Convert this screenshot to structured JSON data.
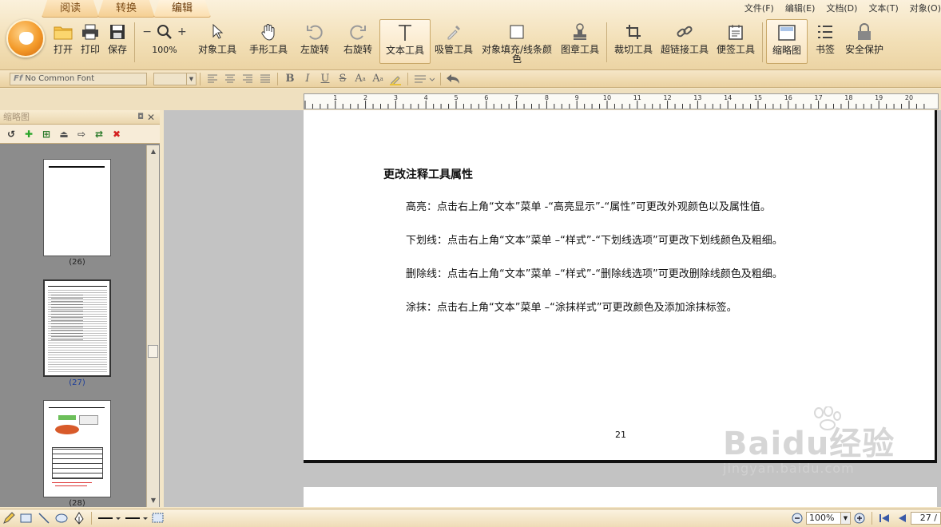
{
  "tabs": [
    "阅读",
    "转换",
    "编辑"
  ],
  "active_tab": "编辑",
  "menubar": [
    "文件(F)",
    "编辑(E)",
    "文档(D)",
    "文本(T)",
    "对象(O)"
  ],
  "toolbar": {
    "open": "打开",
    "print": "打印",
    "save": "保存",
    "zoom_value": "100%",
    "object_tool": "对象工具",
    "hand_tool": "手形工具",
    "rotate_left": "左旋转",
    "rotate_right": "右旋转",
    "text_tool": "文本工具",
    "eyedropper": "吸管工具",
    "fill_stroke": "对象填充/线条颜色",
    "stamp_tool": "图章工具",
    "crop_tool": "裁切工具",
    "link_tool": "超链接工具",
    "note_tool": "便签工具",
    "thumbnail": "缩略图",
    "bookmark": "书签",
    "security": "安全保护"
  },
  "format_bar": {
    "font": "No Common Font",
    "size": ""
  },
  "ruler_numbers": [
    "1",
    "2",
    "3",
    "4",
    "5",
    "6",
    "7",
    "8",
    "9",
    "10",
    "11",
    "12",
    "13",
    "14",
    "15",
    "16",
    "17",
    "18",
    "19",
    "20"
  ],
  "panel": {
    "title": "缩略图",
    "thumbnails": [
      {
        "label": "(26)"
      },
      {
        "label": "(27)"
      },
      {
        "label": "(28)"
      }
    ]
  },
  "document": {
    "title": "更改注释工具属性",
    "paragraphs": [
      "高亮：点击右上角“文本”菜单 -“高亮显示”-“属性”可更改外观颜色以及属性值。",
      "下划线：点击右上角“文本”菜单 –“样式”-“下划线选项”可更改下划线颜色及粗细。",
      "删除线：点击右上角“文本”菜单 –“样式”-“删除线选项”可更改删除线颜色及粗细。",
      "涂抹：点击右上角“文本”菜单 –“涂抹样式”可更改颜色及添加涂抹标签。"
    ],
    "page_number": "21"
  },
  "watermark": {
    "brand": "Baidu经验",
    "url": "jingyan.baidu.com"
  },
  "statusbar": {
    "zoom": "100%",
    "current_page": "27 /"
  },
  "colors": {
    "chrome": "#f2dfb6",
    "accent_orange": "#f39a2a",
    "doc_bg": "#c3c3c3"
  }
}
